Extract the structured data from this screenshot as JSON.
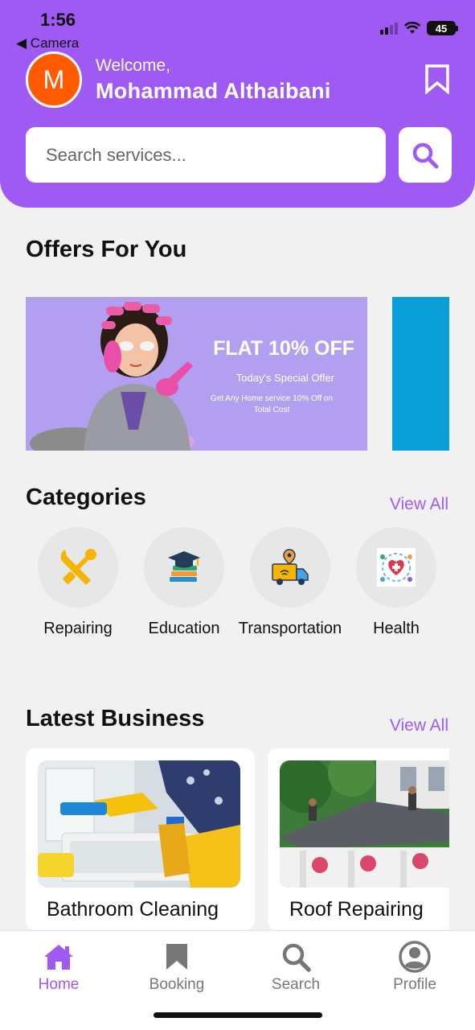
{
  "status_bar": {
    "time": "1:56",
    "back_label": "◀ Camera",
    "battery": "45"
  },
  "header": {
    "avatar_initial": "M",
    "welcome": "Welcome,",
    "user_name": "Mohammad Althaibani",
    "search_placeholder": "Search services..."
  },
  "offers": {
    "title": "Offers For You",
    "banner": {
      "headline": "FLAT 10% OFF",
      "subtitle": "Today's Special Offer",
      "description": "Get Any Home service 10% Off on Total Cost"
    }
  },
  "categories": {
    "title": "Categories",
    "view_all": "View All",
    "items": [
      {
        "label": "Repairing",
        "icon": "tools-icon"
      },
      {
        "label": "Education",
        "icon": "graduation-cap-icon"
      },
      {
        "label": "Transportation",
        "icon": "delivery-truck-icon"
      },
      {
        "label": "Health",
        "icon": "health-icon"
      }
    ]
  },
  "latest_business": {
    "title": "Latest Business",
    "view_all": "View All",
    "items": [
      {
        "name": "Bathroom Cleaning"
      },
      {
        "name": "Roof Repairing"
      }
    ]
  },
  "bottom_nav": {
    "items": [
      {
        "label": "Home",
        "icon": "home-icon",
        "active": true
      },
      {
        "label": "Booking",
        "icon": "bookmark-icon",
        "active": false
      },
      {
        "label": "Search",
        "icon": "search-icon",
        "active": false
      },
      {
        "label": "Profile",
        "icon": "profile-icon",
        "active": false
      }
    ]
  },
  "colors": {
    "accent": "#a05af4",
    "avatar": "#ff5a00",
    "background": "#f1f1f1"
  }
}
